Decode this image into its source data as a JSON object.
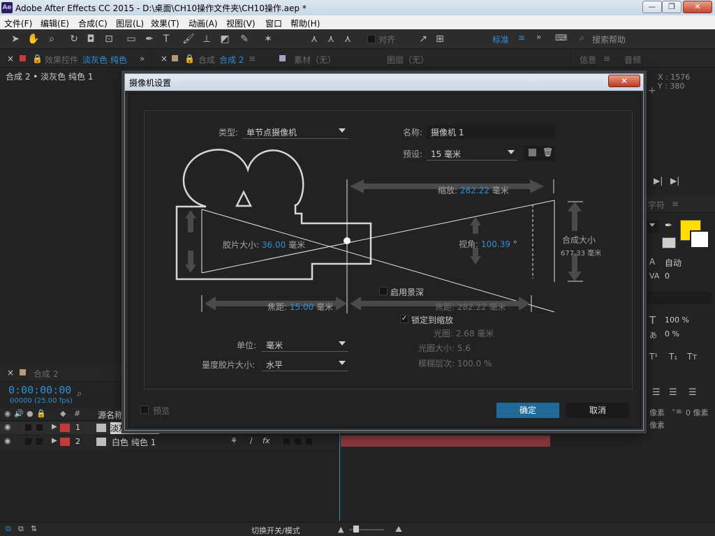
{
  "window": {
    "icon": "Ae",
    "title": "Adobe After Effects CC 2015 - D:\\桌面\\CH10操作文件夹\\CH10操作.aep *",
    "controls": [
      "—",
      "❐",
      "✕"
    ]
  },
  "menubar": [
    "文件(F)",
    "编辑(E)",
    "合成(C)",
    "图层(L)",
    "效果(T)",
    "动画(A)",
    "视图(V)",
    "窗口",
    "帮助(H)"
  ],
  "toolbar": {
    "align_label": "对齐",
    "workspace": "标准",
    "search_placeholder": "搜索帮助"
  },
  "left_panel": {
    "tab_prefix": "效果控件",
    "tab_name": "淡灰色 纯色",
    "breadcrumb": "合成 2 • 淡灰色 纯色 1"
  },
  "comp_panel": {
    "tab_prefix": "合成",
    "tab_name": "合成 2",
    "footage_tab": "素材（无）",
    "layer_tab": "图层（无）"
  },
  "info_panel": {
    "tab_info": "信息",
    "tab_audio": "音频",
    "x_readout": "X : 1576",
    "y_readout": "Y : 380"
  },
  "char_panel": {
    "tab": "字符",
    "tracking": "自动",
    "kerning": "0",
    "v_scale": "100 %",
    "baseline": "0 %",
    "indent_a": "像素",
    "indent_b": "0 像素",
    "indent_c": "像素"
  },
  "colors": {
    "fill_swatch": "#ffdd00",
    "accent": "#2e8fd6",
    "layer_label": "#c23a3a"
  },
  "dialog": {
    "title": "摄像机设置",
    "close": "✕",
    "type_label": "类型:",
    "type_value": "单节点摄像机",
    "name_label": "名称:",
    "name_value": "摄像机 1",
    "preset_label": "预设:",
    "preset_value": "15 毫米",
    "zoom_label": "缩放:",
    "zoom_value": "282.22",
    "zoom_unit": "毫米",
    "film_label": "胶片大小:",
    "film_value": "36.00",
    "film_unit": "毫米",
    "aov_label": "视角:",
    "aov_value": "100.39",
    "aov_unit": "°",
    "comp_size_label": "合成大小",
    "comp_size_value": "677.33 毫米",
    "focal_label": "焦距:",
    "focal_value": "15.00",
    "focal_unit": "毫米",
    "focus_dist_label": "焦距:",
    "focus_dist_value": "282.22",
    "focus_dist_unit": "毫米",
    "dof_label": "启用景深",
    "lock_zoom_label": "锁定到缩放",
    "aperture": "光圈:  2.68 毫米",
    "fstop": "光圈大小:  5.6",
    "blur": "模糊层次:  100.0 %",
    "units_label": "单位:",
    "units_value": "毫米",
    "measure_label": "量度胶片大小:",
    "measure_value": "水平",
    "preview_label": "预览",
    "ok": "确定",
    "cancel": "取消"
  },
  "timeline": {
    "tab": "合成 2",
    "timecode": "0:00:00:00",
    "frames": "00000 (25.00 fps)",
    "source_col": "源名称",
    "layers": [
      {
        "index": "1",
        "name": "淡灰色 纯色 1"
      },
      {
        "index": "2",
        "name": "白色 纯色 1"
      }
    ],
    "switch_modes": "切换开关/模式"
  }
}
